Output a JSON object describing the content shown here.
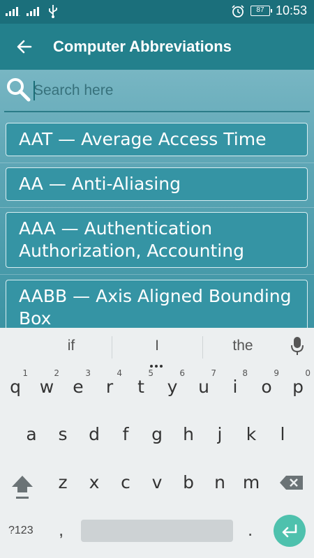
{
  "status_bar": {
    "time": "10:53",
    "battery": "87"
  },
  "app_bar": {
    "title": "Computer Abbreviations"
  },
  "search": {
    "placeholder": "Search here",
    "value": ""
  },
  "list": {
    "items": [
      {
        "label": "AAT — Average Access Time"
      },
      {
        "label": "AA — Anti-Aliasing"
      },
      {
        "label": "AAA — Authentication Authorization, Accounting"
      },
      {
        "label": "AABB — Axis Aligned Bounding Box"
      }
    ]
  },
  "keyboard": {
    "suggestions": [
      "if",
      "I",
      "the"
    ],
    "row1": [
      {
        "key": "q",
        "hint": "1"
      },
      {
        "key": "w",
        "hint": "2"
      },
      {
        "key": "e",
        "hint": "3"
      },
      {
        "key": "r",
        "hint": "4"
      },
      {
        "key": "t",
        "hint": "5"
      },
      {
        "key": "y",
        "hint": "6"
      },
      {
        "key": "u",
        "hint": "7"
      },
      {
        "key": "i",
        "hint": "8"
      },
      {
        "key": "o",
        "hint": "9"
      },
      {
        "key": "p",
        "hint": "0"
      }
    ],
    "row2": [
      "a",
      "s",
      "d",
      "f",
      "g",
      "h",
      "j",
      "k",
      "l"
    ],
    "row3": [
      "z",
      "x",
      "c",
      "v",
      "b",
      "n",
      "m"
    ],
    "symbols_label": "?123",
    "comma": ",",
    "period": ".",
    "accent_color": "#4ec1ad"
  }
}
